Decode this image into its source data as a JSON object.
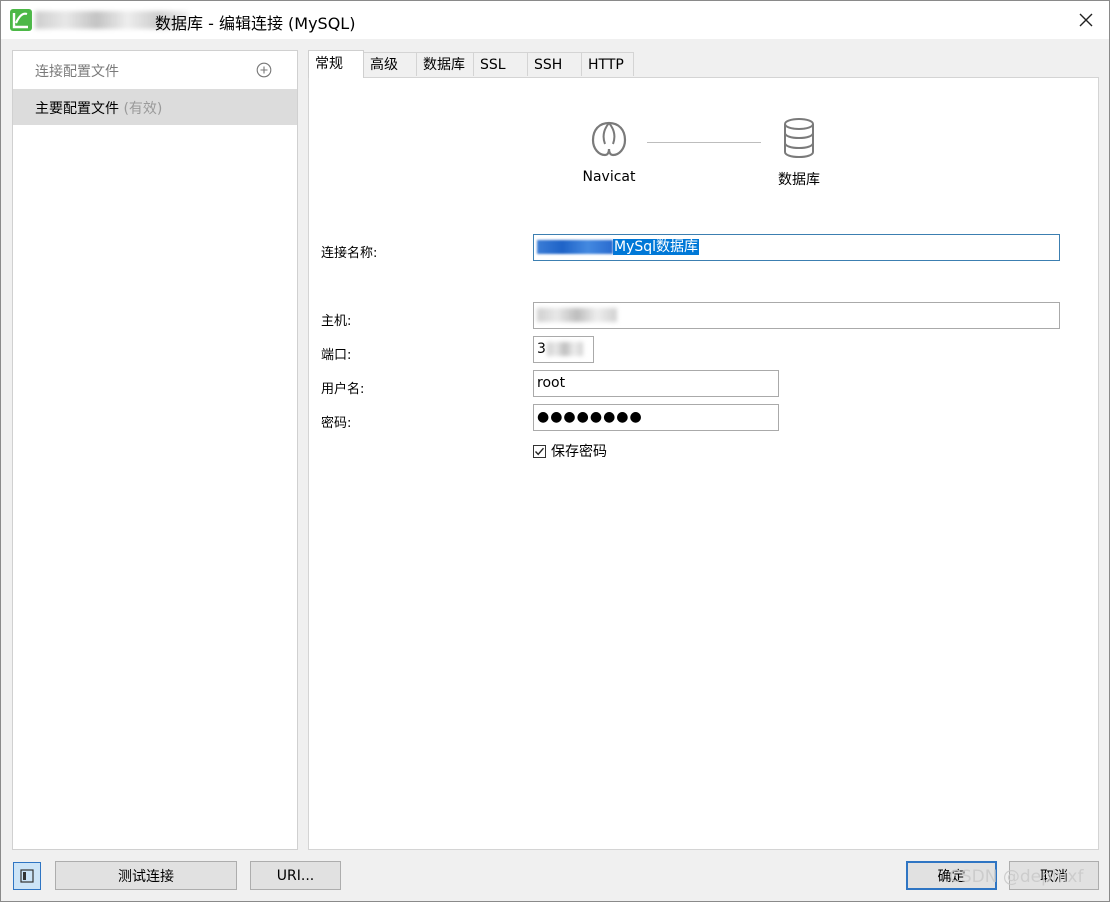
{
  "window": {
    "title": "数据库 - 编辑连接 (MySQL)"
  },
  "profiles": {
    "header_label": "连接配置文件",
    "items": [
      {
        "label": "主要配置文件",
        "status": "(有效)"
      }
    ]
  },
  "tabs": [
    {
      "label": "常规",
      "active": true
    },
    {
      "label": "高级"
    },
    {
      "label": "数据库"
    },
    {
      "label": "SSL"
    },
    {
      "label": "SSH"
    },
    {
      "label": "HTTP"
    }
  ],
  "diagram": {
    "left_label": "Navicat",
    "right_label": "数据库"
  },
  "form": {
    "connection_name_label": "连接名称:",
    "connection_name_value": "MySql数据库",
    "host_label": "主机:",
    "port_label": "端口:",
    "port_value_visible": "3",
    "username_label": "用户名:",
    "username_value": "root",
    "password_label": "密码:",
    "password_value": "●●●●●●●●",
    "save_password_label": "保存密码",
    "save_password_checked": true
  },
  "buttons": {
    "test_connection": "测试连接",
    "uri": "URI...",
    "ok": "确定",
    "cancel": "取消"
  },
  "watermark": "CSDN @dephixf",
  "colors": {
    "selection": "#0078d7",
    "focus_border": "#3c7fb1",
    "navicat_green": "#4cb847"
  }
}
